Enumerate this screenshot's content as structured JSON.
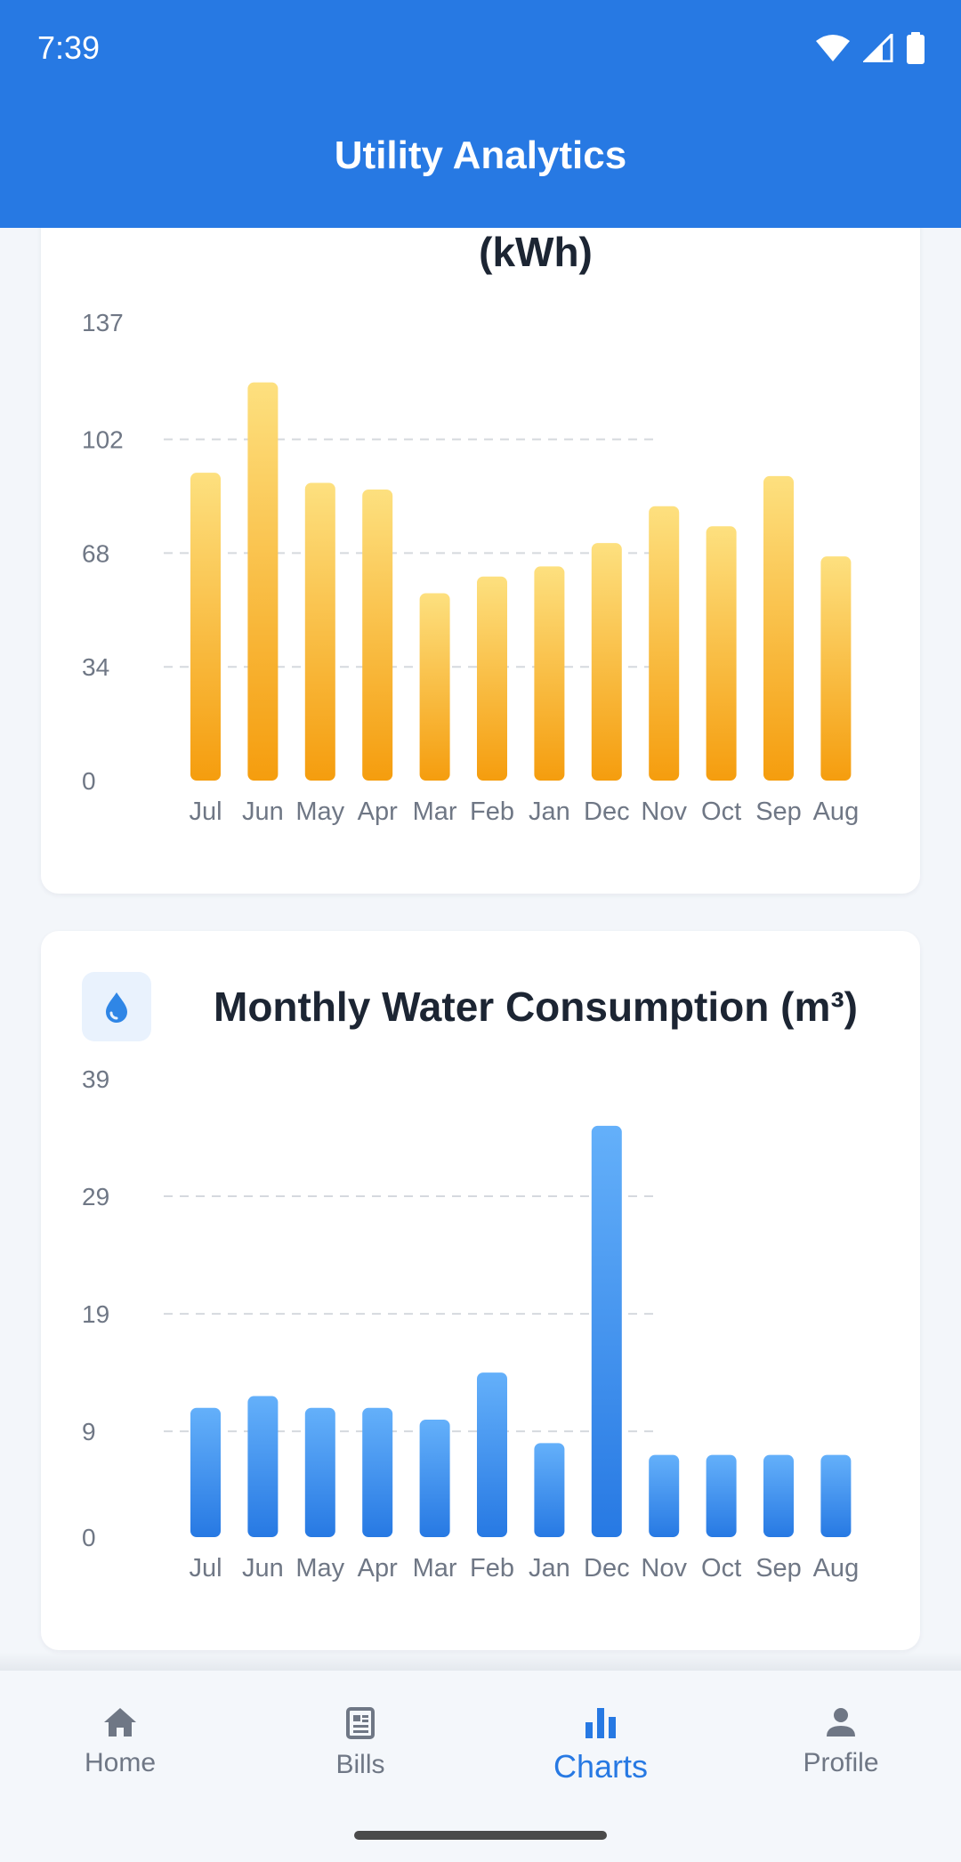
{
  "status_bar": {
    "time": "7:39"
  },
  "app_bar": {
    "title": "Utility Analytics"
  },
  "electricity_card": {
    "title": "(kWh)",
    "icon": "trend-icon"
  },
  "water_card": {
    "title": "Monthly Water Consumption (m³)",
    "icon": "water-drop-icon"
  },
  "chart_data": [
    {
      "type": "bar",
      "title": "(kWh)",
      "categories": [
        "Jul",
        "Jun",
        "May",
        "Apr",
        "Mar",
        "Feb",
        "Jan",
        "Dec",
        "Nov",
        "Oct",
        "Sep",
        "Aug"
      ],
      "values": [
        92,
        119,
        89,
        87,
        56,
        61,
        64,
        71,
        82,
        76,
        91,
        67
      ],
      "yticks": [
        0,
        34,
        68,
        102,
        137
      ],
      "ylim": [
        0,
        137
      ],
      "grid": true,
      "gradient": [
        "#fde07f",
        "#f59d0e"
      ]
    },
    {
      "type": "bar",
      "title": "Monthly Water Consumption (m³)",
      "categories": [
        "Jul",
        "Jun",
        "May",
        "Apr",
        "Mar",
        "Feb",
        "Jan",
        "Dec",
        "Nov",
        "Oct",
        "Sep",
        "Aug"
      ],
      "values": [
        11,
        12,
        11,
        11,
        10,
        14,
        8,
        35,
        7,
        7,
        7,
        7
      ],
      "yticks": [
        0,
        9,
        19,
        29,
        39
      ],
      "ylim": [
        0,
        39
      ],
      "grid": true,
      "gradient": [
        "#64b0fa",
        "#2779e3"
      ]
    }
  ],
  "bottom_nav": {
    "items": [
      {
        "label": "Home",
        "icon": "home-icon"
      },
      {
        "label": "Bills",
        "icon": "receipt-icon"
      },
      {
        "label": "Charts",
        "icon": "bar-chart-icon"
      },
      {
        "label": "Profile",
        "icon": "person-icon"
      }
    ],
    "active": "Charts",
    "active_color": "#2779e3"
  }
}
